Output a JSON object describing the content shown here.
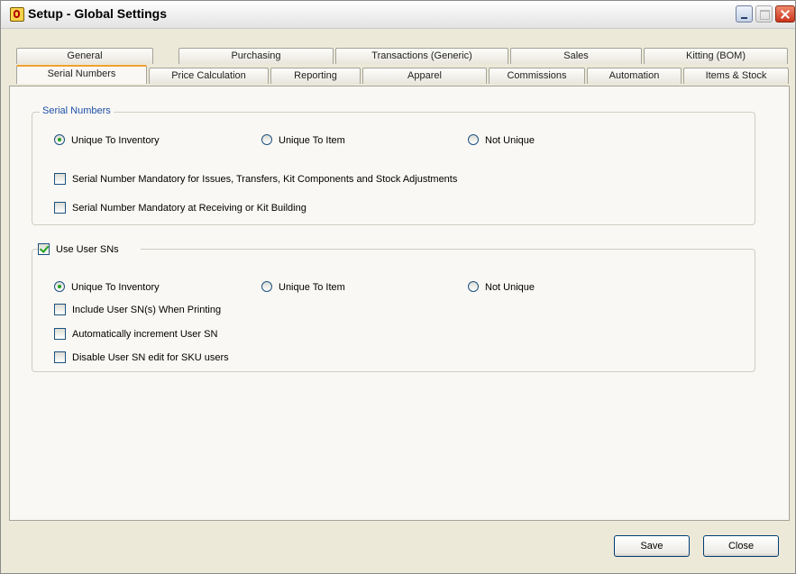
{
  "window": {
    "title": "Setup - Global Settings"
  },
  "tabs_row1": [
    {
      "label": "General"
    },
    {
      "label": "Purchasing"
    },
    {
      "label": "Transactions (Generic)"
    },
    {
      "label": "Sales"
    },
    {
      "label": "Kitting (BOM)"
    }
  ],
  "tabs_row2": [
    {
      "label": "Serial Numbers",
      "active": true
    },
    {
      "label": "Price Calculation"
    },
    {
      "label": "Reporting"
    },
    {
      "label": "Apparel"
    },
    {
      "label": "Commissions"
    },
    {
      "label": "Automation"
    },
    {
      "label": "Items & Stock"
    }
  ],
  "serial_numbers": {
    "group_title": "Serial Numbers",
    "radios": [
      {
        "label": "Unique To Inventory",
        "selected": true
      },
      {
        "label": "Unique To Item",
        "selected": false
      },
      {
        "label": "Not Unique",
        "selected": false
      }
    ],
    "checks": [
      {
        "label": "Serial Number Mandatory for Issues, Transfers, Kit Components and Stock Adjustments",
        "checked": false
      },
      {
        "label": "Serial Number Mandatory at Receiving or Kit Building",
        "checked": false
      }
    ]
  },
  "user_sns": {
    "toggle_label": "Use User SNs",
    "toggle_checked": true,
    "radios": [
      {
        "label": "Unique To Inventory",
        "selected": true
      },
      {
        "label": "Unique To Item",
        "selected": false
      },
      {
        "label": "Not Unique",
        "selected": false
      }
    ],
    "checks": [
      {
        "label": "Include User SN(s) When Printing",
        "checked": false
      },
      {
        "label": "Automatically increment User SN",
        "checked": false
      },
      {
        "label": "Disable User SN edit for SKU users",
        "checked": false
      }
    ]
  },
  "buttons": {
    "save": "Save",
    "close": "Close"
  }
}
